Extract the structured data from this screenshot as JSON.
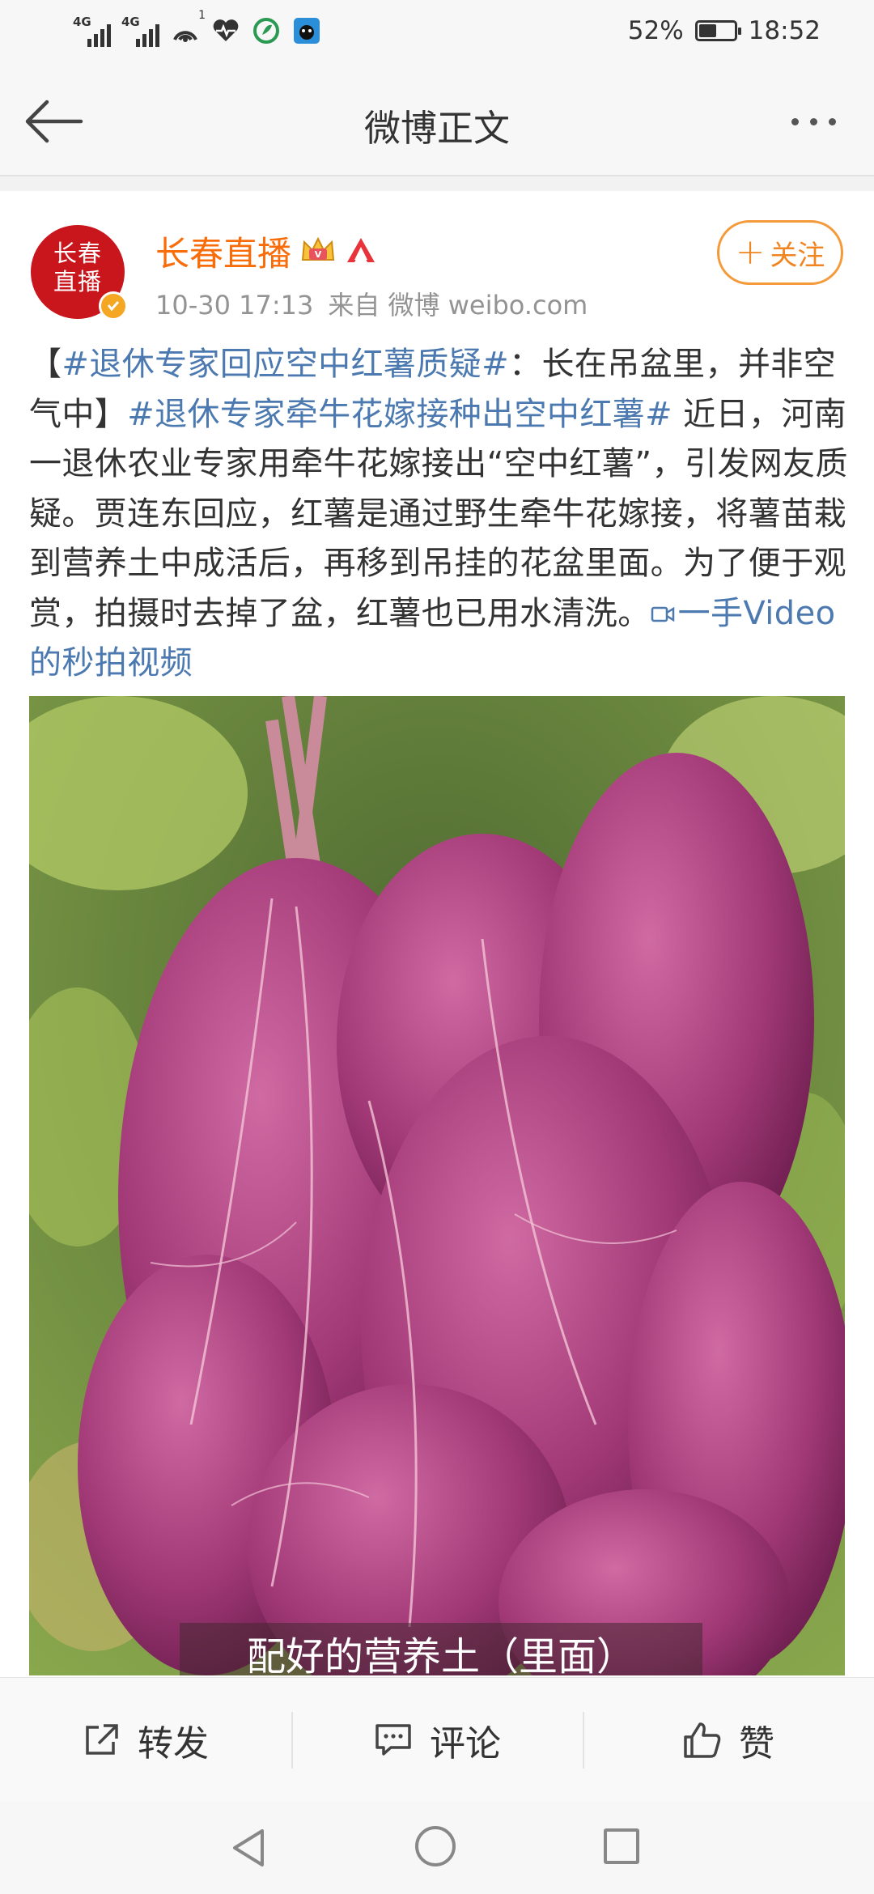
{
  "status_bar": {
    "network_1": "4G",
    "network_2": "4G",
    "hotspot_count": "1",
    "battery": "52%",
    "battery_level": 0.52,
    "time": "18:52"
  },
  "nav": {
    "title": "微博正文"
  },
  "post": {
    "author": "长春直播",
    "avatar_text_line1": "长春",
    "avatar_text_line2": "直播",
    "timestamp": "10-30 17:13",
    "source": "来自 微博 weibo.com",
    "follow_label": "关注",
    "text": {
      "open_bracket": "【",
      "tag1": "#退休专家回应空中红薯质疑#",
      "part1": "：长在吊盆里，并非空气中】",
      "tag2": "#退休专家牵牛花嫁接种出空中红薯#",
      "part2": " 近日，河南一退休农业专家用牵牛花嫁接出“空中红薯”，引发网友质疑。贾连东回应，红薯是通过野生牵牛花嫁接，将薯苗栽到营养土中成活后，再移到吊挂的花盆里面。为了便于观赏，拍摄时去掉了盆，红薯也已用水清洗。",
      "video_link": "一手Video的秒拍视频"
    },
    "image_caption": "配好的营养土（里面）"
  },
  "actions": {
    "repost": "转发",
    "comment": "评论",
    "like": "赞"
  },
  "colors": {
    "accent_orange": "#f86c0a",
    "link_blue": "#4b79b0",
    "avatar_red": "#c9151c"
  },
  "icons": [
    "back-arrow-icon",
    "more-icon",
    "crown-icon",
    "vip-icon",
    "verified-icon",
    "video-icon",
    "repost-icon",
    "comment-icon",
    "like-icon",
    "nav-back-icon",
    "nav-home-icon",
    "nav-recent-icon"
  ]
}
